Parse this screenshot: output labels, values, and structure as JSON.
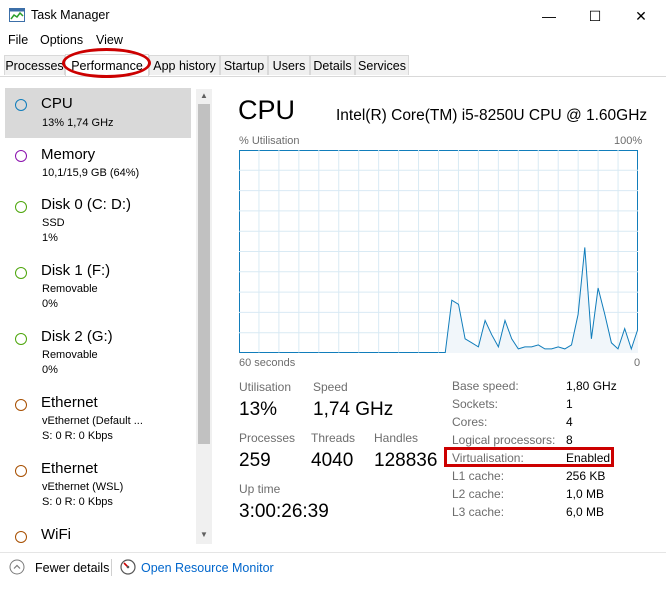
{
  "window": {
    "title": "Task Manager",
    "controls": {
      "minimize": "—",
      "maximize": "☐",
      "close": "✕"
    }
  },
  "menu": [
    "File",
    "Options",
    "View"
  ],
  "tabs": [
    {
      "label": "Processes",
      "active": false
    },
    {
      "label": "Performance",
      "active": true
    },
    {
      "label": "App history",
      "active": false
    },
    {
      "label": "Startup",
      "active": false
    },
    {
      "label": "Users",
      "active": false
    },
    {
      "label": "Details",
      "active": false
    },
    {
      "label": "Services",
      "active": false
    }
  ],
  "sidebar": {
    "items": [
      {
        "title": "CPU",
        "lines": [
          "13% 1,74 GHz"
        ],
        "color": "#117dbb",
        "selected": true
      },
      {
        "title": "Memory",
        "lines": [
          "10,1/15,9 GB (64%)"
        ],
        "color": "#8b12ae",
        "selected": false
      },
      {
        "title": "Disk 0 (C: D:)",
        "lines": [
          "SSD",
          "1%"
        ],
        "color": "#4da60c",
        "selected": false
      },
      {
        "title": "Disk 1 (F:)",
        "lines": [
          "Removable",
          "0%"
        ],
        "color": "#4da60c",
        "selected": false
      },
      {
        "title": "Disk 2 (G:)",
        "lines": [
          "Removable",
          "0%"
        ],
        "color": "#4da60c",
        "selected": false
      },
      {
        "title": "Ethernet",
        "lines": [
          "vEthernet (Default ...",
          "S: 0 R: 0 Kbps"
        ],
        "color": "#a74f01",
        "selected": false
      },
      {
        "title": "Ethernet",
        "lines": [
          "vEthernet (WSL)",
          "S: 0 R: 0 Kbps"
        ],
        "color": "#a74f01",
        "selected": false
      },
      {
        "title": "WiFi",
        "lines": [],
        "color": "#a74f01",
        "selected": false
      }
    ]
  },
  "main": {
    "heading": "CPU",
    "model": "Intel(R) Core(TM) i5-8250U CPU @ 1.60GHz",
    "graph": {
      "top_left": "% Utilisation",
      "top_right": "100%",
      "bottom_left": "60 seconds",
      "bottom_right": "0"
    },
    "stats": {
      "utilisation_label": "Utilisation",
      "utilisation_value": "13%",
      "speed_label": "Speed",
      "speed_value": "1,74 GHz",
      "processes_label": "Processes",
      "processes_value": "259",
      "threads_label": "Threads",
      "threads_value": "4040",
      "handles_label": "Handles",
      "handles_value": "128836",
      "uptime_label": "Up time",
      "uptime_value": "3:00:26:39"
    },
    "specs": [
      {
        "label": "Base speed:",
        "value": "1,80 GHz"
      },
      {
        "label": "Sockets:",
        "value": "1"
      },
      {
        "label": "Cores:",
        "value": "4"
      },
      {
        "label": "Logical processors:",
        "value": "8"
      },
      {
        "label": "Virtualisation:",
        "value": "Enabled"
      },
      {
        "label": "L1 cache:",
        "value": "256 KB"
      },
      {
        "label": "L2 cache:",
        "value": "1,0 MB"
      },
      {
        "label": "L3 cache:",
        "value": "6,0 MB"
      }
    ]
  },
  "footer": {
    "fewer_details": "Fewer details",
    "resource_monitor": "Open Resource Monitor"
  },
  "chart_data": {
    "type": "area",
    "x": [
      60,
      59,
      58,
      57,
      56,
      55,
      54,
      53,
      52,
      51,
      50,
      49,
      48,
      47,
      46,
      45,
      44,
      43,
      42,
      41,
      40,
      39,
      38,
      37,
      36,
      35,
      34,
      33,
      32,
      31,
      30,
      29,
      28,
      27,
      26,
      25,
      24,
      23,
      22,
      21,
      20,
      19,
      18,
      17,
      16,
      15,
      14,
      13,
      12,
      11,
      10,
      9,
      8,
      7,
      6,
      5,
      4,
      3,
      2,
      1,
      0
    ],
    "series": [
      {
        "values": [
          0,
          0,
          0,
          0,
          0,
          0,
          0,
          0,
          0,
          0,
          0,
          0,
          0,
          0,
          0,
          0,
          0,
          0,
          0,
          0,
          0,
          0,
          0,
          0,
          0,
          0,
          0,
          0,
          0,
          0,
          0,
          0,
          26,
          24,
          7,
          5,
          3,
          16,
          9,
          3,
          16,
          7,
          2,
          3,
          3,
          4,
          2,
          2,
          3,
          2,
          4,
          19,
          52,
          7,
          32,
          19,
          5,
          2,
          12,
          2,
          12
        ]
      }
    ],
    "ylim": [
      0,
      100
    ],
    "accent": "#117dbb",
    "fill": "#f1f6fa"
  }
}
